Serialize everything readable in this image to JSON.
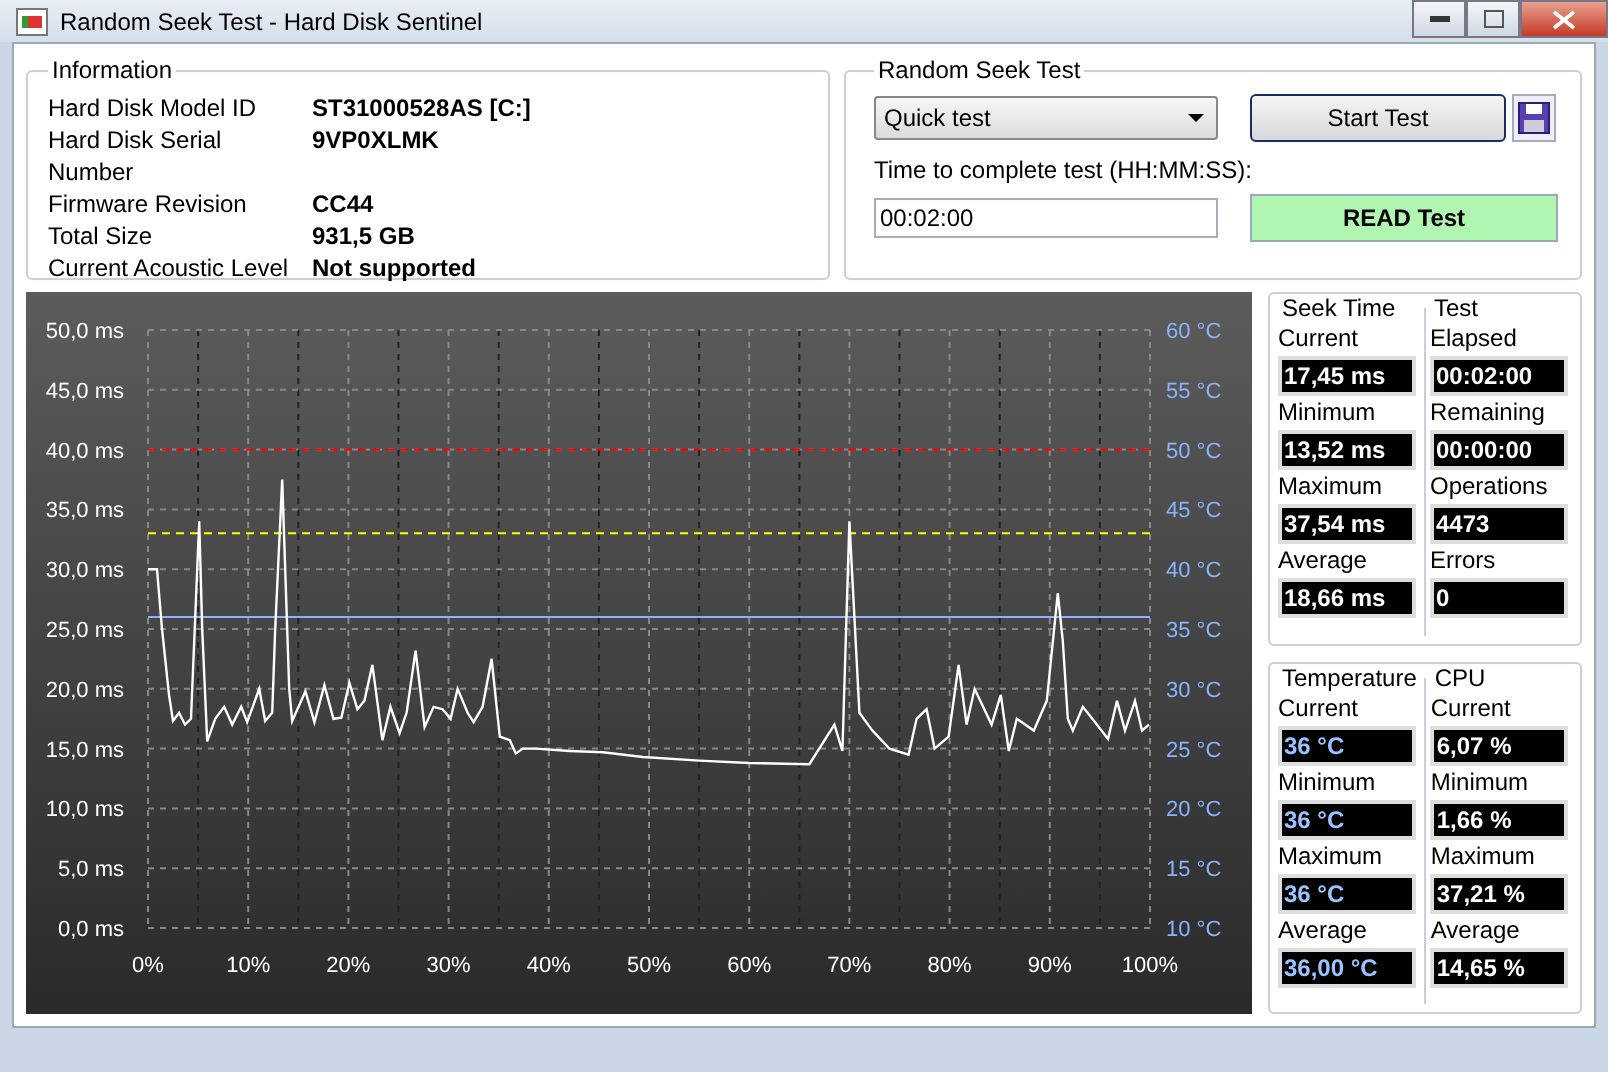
{
  "window": {
    "title": "Random Seek Test - Hard Disk Sentinel"
  },
  "information": {
    "title": "Information",
    "rows": [
      {
        "label": "Hard Disk Model ID",
        "value": "ST31000528AS [C:]"
      },
      {
        "label": "Hard Disk Serial Number",
        "value": "9VP0XLMK"
      },
      {
        "label": "Firmware Revision",
        "value": "CC44"
      },
      {
        "label": "Total Size",
        "value": "931,5 GB"
      },
      {
        "label": "Current Acoustic Level",
        "value": "Not supported"
      }
    ]
  },
  "random_seek_test": {
    "title": "Random Seek Test",
    "test_type": "Quick test",
    "start_button": "Start Test",
    "time_label": "Time to complete test (HH:MM:SS):",
    "time_value": "00:02:00",
    "read_button": "READ Test"
  },
  "chart": {
    "chart_data": {
      "type": "line",
      "x": [
        0,
        0.9,
        1.4,
        2.1,
        2.5,
        3.1,
        3.7,
        4.3,
        5.1,
        5.4,
        5.9,
        6.7,
        7.6,
        8.4,
        9.3,
        9.9,
        11.1,
        11.7,
        12.4,
        12.7,
        13.4,
        14.1,
        14.4,
        15.7,
        16.6,
        17.6,
        18.5,
        19.3,
        20.1,
        20.9,
        21.6,
        22.4,
        23.4,
        24.2,
        25.1,
        25.8,
        26.7,
        27.6,
        28.5,
        29.4,
        30.2,
        30.9,
        31.9,
        32.5,
        33.4,
        34.3,
        35.1,
        36.1,
        36.7,
        37.4,
        38.7,
        42.1,
        45.4,
        49.4,
        55,
        60,
        66,
        68.5,
        69.3,
        70,
        71,
        72.3,
        74,
        75.9,
        76.7,
        77.7,
        78.5,
        79.9,
        80.9,
        81.7,
        82.5,
        84.2,
        85.1,
        85.9,
        86.7,
        88.4,
        89.7,
        90.8,
        91.3,
        91.8,
        92.3,
        93.3,
        94.7,
        95.8,
        96.7,
        97.5,
        98.5,
        99.2,
        99.9
      ],
      "series": [
        {
          "color": "#ffffff",
          "values": [
            30,
            30,
            25,
            19.5,
            17.3,
            18,
            17,
            17.5,
            34,
            25,
            15.6,
            17.5,
            18.5,
            17,
            18.5,
            17.2,
            20,
            17.3,
            18,
            25,
            37.5,
            20,
            17.3,
            19.8,
            17.2,
            20.3,
            17.5,
            17.6,
            20.5,
            18.3,
            19,
            22,
            15.7,
            18.5,
            16.3,
            18,
            23.2,
            16.8,
            18.5,
            18.3,
            17.5,
            20,
            18,
            17.2,
            18.5,
            22.5,
            16,
            15.7,
            14.6,
            15,
            15,
            14.8,
            14.7,
            14.3,
            14,
            13.8,
            13.7,
            17,
            14.8,
            34,
            18,
            16.5,
            15,
            14.5,
            17.5,
            18.3,
            15,
            16,
            22,
            17,
            20,
            17,
            19.5,
            14.8,
            17.5,
            16.5,
            19,
            28,
            24,
            17.5,
            16.5,
            18.5,
            17,
            15.8,
            19,
            16.5,
            19,
            16.5,
            17
          ]
        }
      ],
      "xlim": [
        0,
        100
      ],
      "ylim": [
        0,
        50
      ],
      "xticks": [
        {
          "value": 0,
          "label": "0%"
        },
        {
          "value": 10,
          "label": "10%"
        },
        {
          "value": 20,
          "label": "20%"
        },
        {
          "value": 30,
          "label": "30%"
        },
        {
          "value": 40,
          "label": "40%"
        },
        {
          "value": 50,
          "label": "50%"
        },
        {
          "value": 60,
          "label": "60%"
        },
        {
          "value": 70,
          "label": "70%"
        },
        {
          "value": 80,
          "label": "80%"
        },
        {
          "value": 90,
          "label": "90%"
        },
        {
          "value": 100,
          "label": "100%"
        }
      ],
      "yticks": [
        {
          "value": 0,
          "label": "0,0 ms"
        },
        {
          "value": 5,
          "label": "5,0 ms"
        },
        {
          "value": 10,
          "label": "10,0 ms"
        },
        {
          "value": 15,
          "label": "15,0 ms"
        },
        {
          "value": 20,
          "label": "20,0 ms"
        },
        {
          "value": 25,
          "label": "25,0 ms"
        },
        {
          "value": 30,
          "label": "30,0 ms"
        },
        {
          "value": 35,
          "label": "35,0 ms"
        },
        {
          "value": 40,
          "label": "40,0 ms"
        },
        {
          "value": 45,
          "label": "45,0 ms"
        },
        {
          "value": 50,
          "label": "50,0 ms"
        }
      ],
      "y2lim": [
        10,
        60
      ],
      "y2ticks": [
        {
          "value": 10,
          "label": "10 °C"
        },
        {
          "value": 15,
          "label": "15 °C"
        },
        {
          "value": 20,
          "label": "20 °C"
        },
        {
          "value": 25,
          "label": "25 °C"
        },
        {
          "value": 30,
          "label": "30 °C"
        },
        {
          "value": 35,
          "label": "35 °C"
        },
        {
          "value": 40,
          "label": "40 °C"
        },
        {
          "value": 45,
          "label": "45 °C"
        },
        {
          "value": 50,
          "label": "50 °C"
        },
        {
          "value": 55,
          "label": "55 °C"
        },
        {
          "value": 60,
          "label": "60 °C"
        }
      ],
      "grid": true,
      "ref_lines": [
        {
          "axis": "y",
          "value": 40,
          "color": "#ff0000"
        },
        {
          "axis": "y",
          "value": 33,
          "color": "#ffff00"
        },
        {
          "axis": "y2",
          "value": 36,
          "color": "#88b4ff"
        }
      ]
    }
  },
  "stat_panels": [
    {
      "groups": [
        {
          "title": "Seek Time",
          "kind": "seek_time",
          "items": [
            {
              "label": "Current",
              "value": "17,45 ms"
            },
            {
              "label": "Minimum",
              "value": "13,52 ms"
            },
            {
              "label": "Maximum",
              "value": "37,54 ms"
            },
            {
              "label": "Average",
              "value": "18,66 ms"
            }
          ]
        },
        {
          "title": "Test",
          "kind": "test",
          "items": [
            {
              "label": "Elapsed",
              "value": "00:02:00"
            },
            {
              "label": "Remaining",
              "value": "00:00:00"
            },
            {
              "label": "Operations",
              "value": "4473"
            },
            {
              "label": "Errors",
              "value": "0"
            }
          ]
        }
      ]
    },
    {
      "groups": [
        {
          "title": "Temperature",
          "kind": "temperature",
          "items": [
            {
              "label": "Current",
              "value": "36 °C"
            },
            {
              "label": "Minimum",
              "value": "36 °C"
            },
            {
              "label": "Maximum",
              "value": "36 °C"
            },
            {
              "label": "Average",
              "value": "36,00 °C"
            }
          ]
        },
        {
          "title": "CPU",
          "kind": "cpu",
          "items": [
            {
              "label": "Current",
              "value": "6,07 %"
            },
            {
              "label": "Minimum",
              "value": "1,66 %"
            },
            {
              "label": "Maximum",
              "value": "37,21 %"
            },
            {
              "label": "Average",
              "value": "14,65 %"
            }
          ]
        }
      ]
    }
  ]
}
